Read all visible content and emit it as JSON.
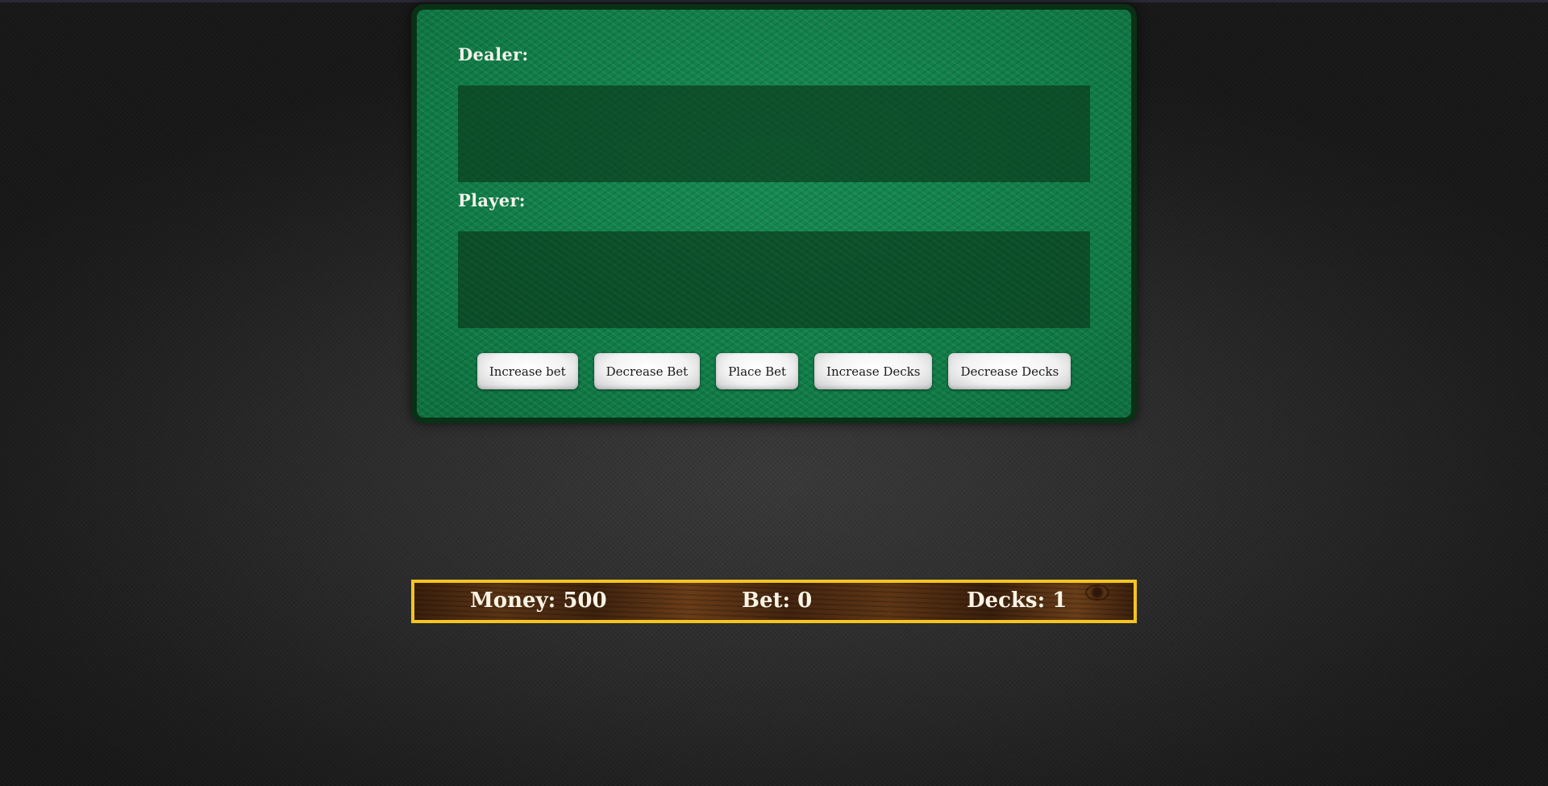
{
  "table": {
    "dealer_label": "Dealer:",
    "player_label": "Player:"
  },
  "controls": {
    "increase_bet": "Increase bet",
    "decrease_bet": "Decrease Bet",
    "place_bet": "Place Bet",
    "increase_decks": "Increase Decks",
    "decrease_decks": "Decrease Decks"
  },
  "status": {
    "money": "Money: 500",
    "bet": "Bet: 0",
    "decks": "Decks: 1"
  },
  "colors": {
    "felt": "#11814b",
    "table_border": "#0a3016",
    "status_border": "#f3c422",
    "wood": "#4a2a10"
  }
}
